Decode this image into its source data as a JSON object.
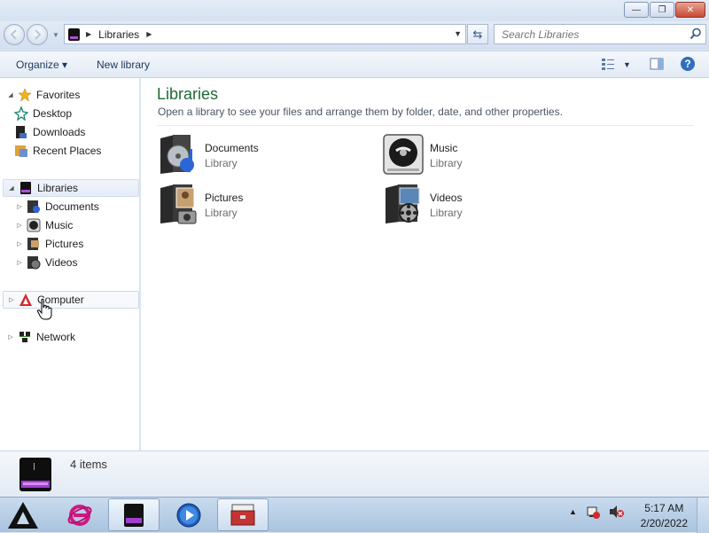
{
  "window": {
    "controls": {
      "minimize": "—",
      "maximize": "❐",
      "close": "✕"
    }
  },
  "address": {
    "crumb": "Libraries",
    "search_placeholder": "Search Libraries"
  },
  "toolbar": {
    "organize": "Organize ▾",
    "new_library": "New library"
  },
  "sidebar": {
    "favorites": "Favorites",
    "favorites_items": [
      "Desktop",
      "Downloads",
      "Recent Places"
    ],
    "libraries": "Libraries",
    "libraries_items": [
      "Documents",
      "Music",
      "Pictures",
      "Videos"
    ],
    "computer": "Computer",
    "network": "Network"
  },
  "main": {
    "title": "Libraries",
    "subtitle": "Open a library to see your files and arrange them by folder, date, and other properties.",
    "libraries": [
      {
        "name": "Documents",
        "type": "Library"
      },
      {
        "name": "Music",
        "type": "Library"
      },
      {
        "name": "Pictures",
        "type": "Library"
      },
      {
        "name": "Videos",
        "type": "Library"
      }
    ]
  },
  "details": {
    "count": "4 items"
  },
  "taskbar": {
    "time": "5:17 AM",
    "date": "2/20/2022",
    "tray_arrow": "▲"
  }
}
